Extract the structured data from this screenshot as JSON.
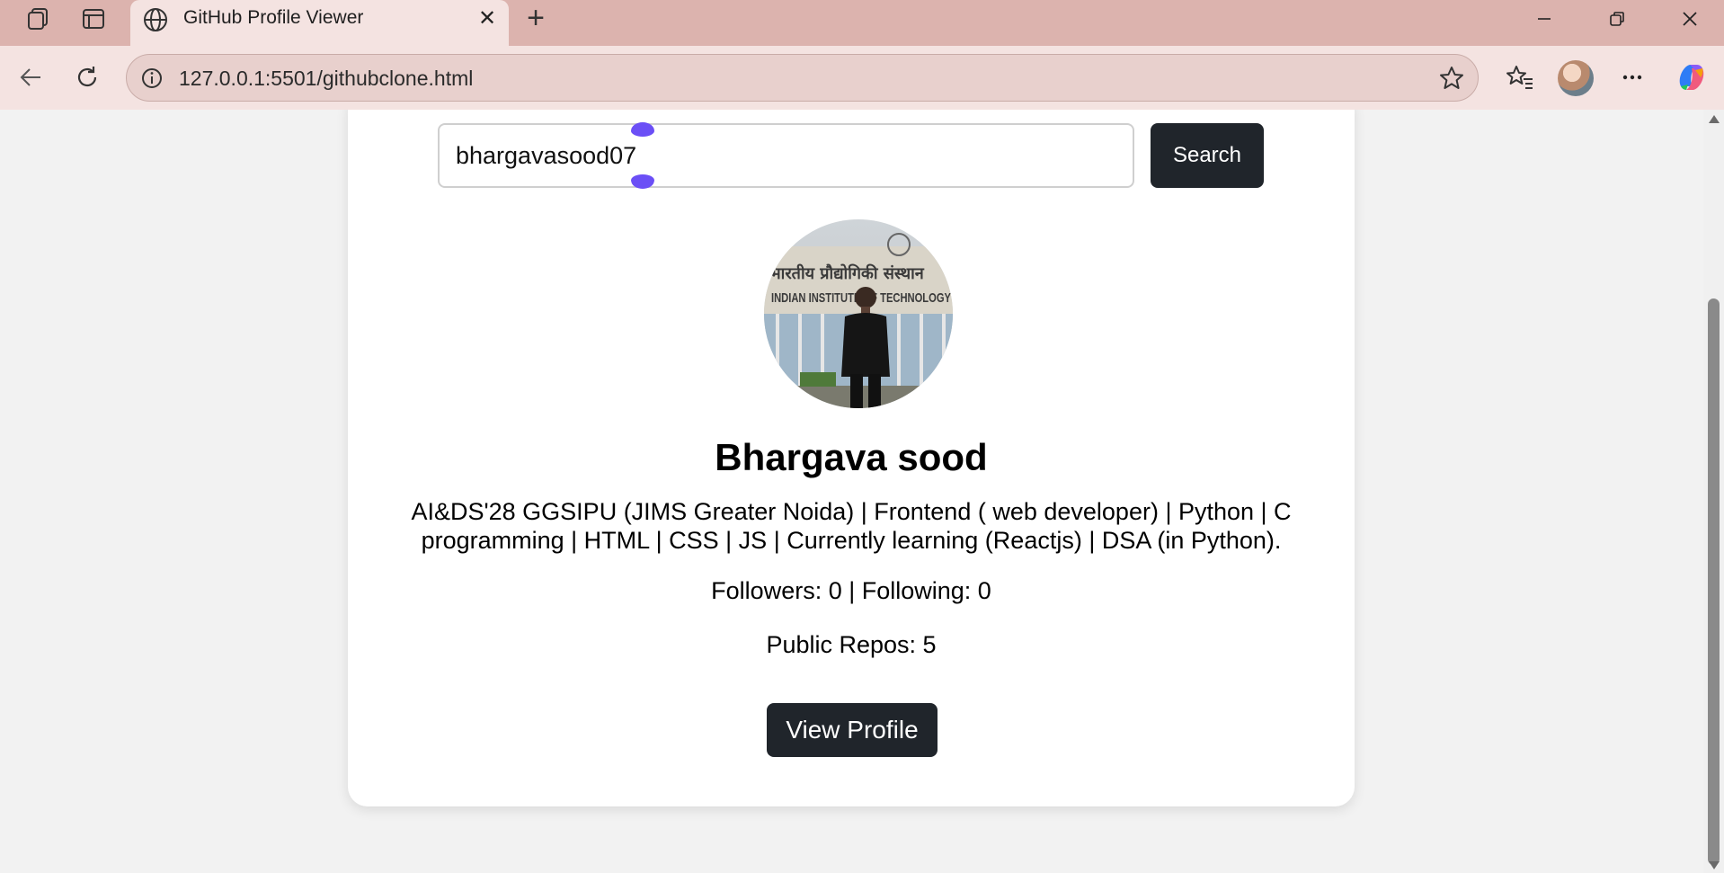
{
  "browser": {
    "tab_title": "GitHub Profile Viewer",
    "url": "127.0.0.1:5501/githubclone.html",
    "icons": [
      "collections-icon",
      "vertical-tabs-icon",
      "globe-icon",
      "close-icon",
      "new-tab-icon",
      "minimize-icon",
      "restore-icon",
      "window-close-icon",
      "back-icon",
      "refresh-icon",
      "info-icon",
      "favorite-star-icon",
      "favorites-list-icon",
      "more-icon",
      "copilot-icon"
    ]
  },
  "search": {
    "value": "bhargavasood07",
    "button_label": "Search"
  },
  "profile": {
    "name": "Bhargava sood",
    "bio": "AI&DS'28 GGSIPU (JIMS Greater Noida) | Frontend ( web developer) | Python | C programming | HTML | CSS | JS | Currently learning (Reactjs) | DSA (in Python).",
    "stats": "Followers: 0 | Following: 0",
    "repos": "Public Repos: 5",
    "view_profile_label": "View Profile",
    "avatar_signage_hindi": "भारतीय प्रौद्योगिकी संस्थान",
    "avatar_signage_english": "INDIAN INSTITUTE OF TECHNOLOGY"
  },
  "colors": {
    "titlebar": "#dcb3ae",
    "toolbar": "#f4e3e1",
    "button_dark": "#20252b",
    "caret_handle": "#6b4ff6"
  }
}
